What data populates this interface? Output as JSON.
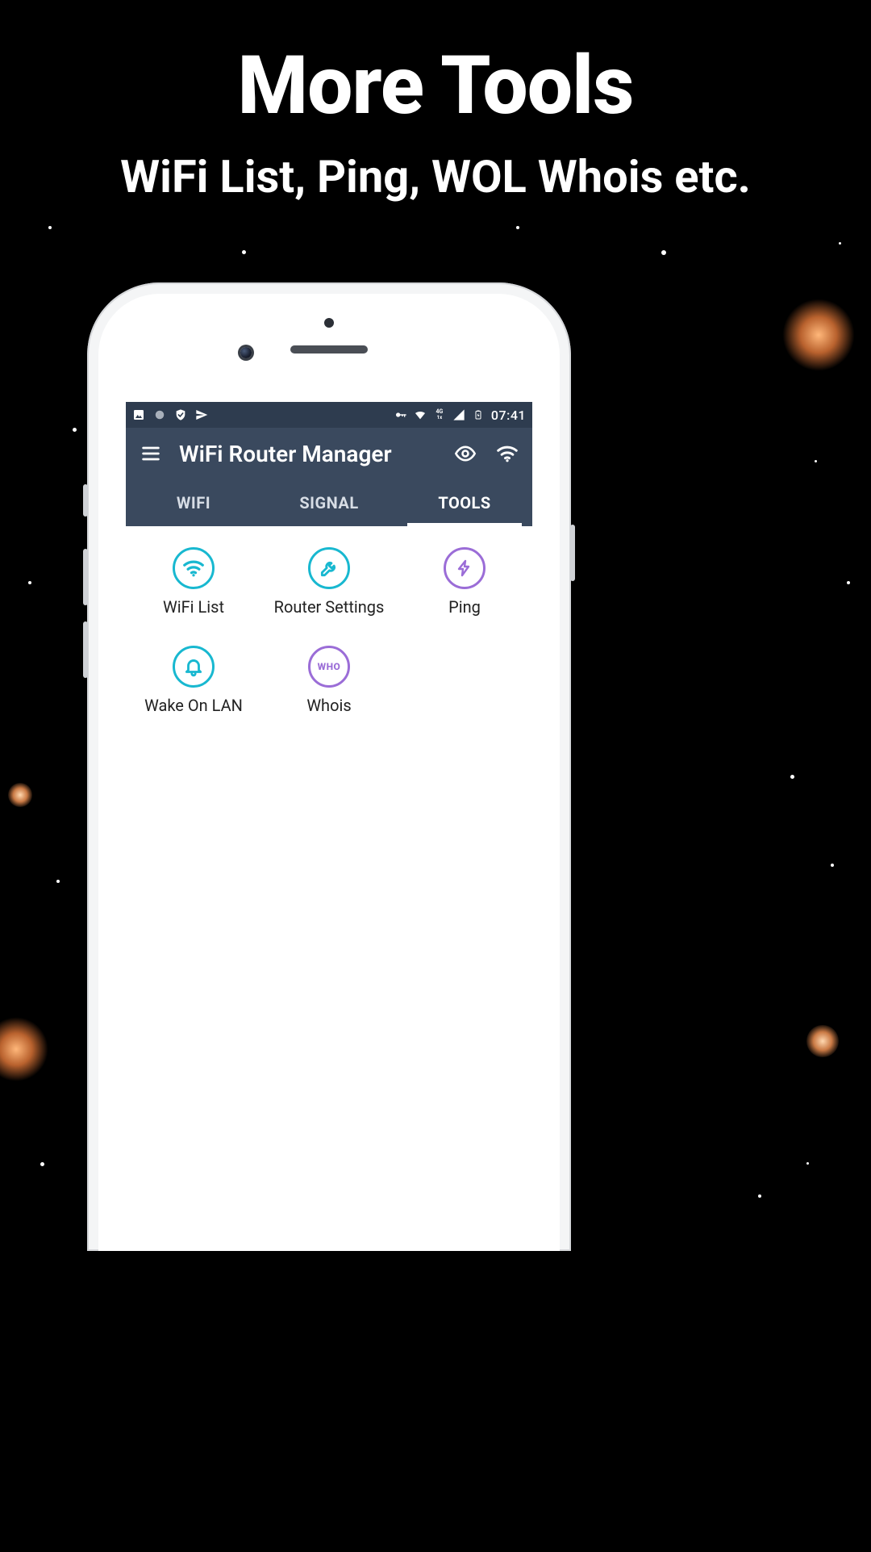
{
  "promo": {
    "title": "More Tools",
    "subtitle": "WiFi List, Ping, WOL Whois etc."
  },
  "statusbar": {
    "time": "07:41",
    "data_label": "4G"
  },
  "appbar": {
    "title": "WiFi Router Manager"
  },
  "tabs": [
    {
      "label": "WIFI",
      "active": false
    },
    {
      "label": "SIGNAL",
      "active": false
    },
    {
      "label": "TOOLS",
      "active": true
    }
  ],
  "tools": [
    {
      "label": "WiFi List",
      "icon": "wifi",
      "color": "cyan"
    },
    {
      "label": "Router Settings",
      "icon": "wrench",
      "color": "cyan"
    },
    {
      "label": "Ping",
      "icon": "bolt",
      "color": "purple"
    },
    {
      "label": "Wake On LAN",
      "icon": "bell",
      "color": "cyan"
    },
    {
      "label": "Whois",
      "icon": "who",
      "color": "purple",
      "who_text": "WHO"
    }
  ]
}
